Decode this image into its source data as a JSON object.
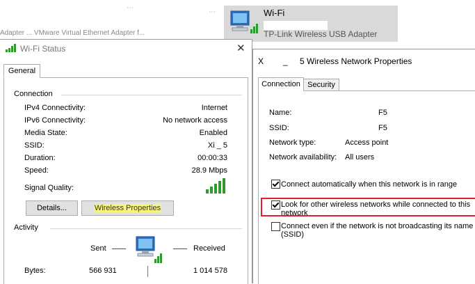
{
  "background": {
    "crumb_text": "Adapter ...      VMware Virtual Ethernet Adapter f...",
    "wifi_item": {
      "name": "Wi-Fi",
      "adapter": "TP-Link Wireless USB Adapter"
    }
  },
  "status_dialog": {
    "title": "Wi-Fi Status",
    "tab": "General",
    "connection_heading": "Connection",
    "rows": [
      {
        "label": "IPv4 Connectivity:",
        "value": "Internet"
      },
      {
        "label": "IPv6 Connectivity:",
        "value": "No network access"
      },
      {
        "label": "Media State:",
        "value": "Enabled"
      },
      {
        "label": "SSID:",
        "value": "Xi _ 5"
      },
      {
        "label": "Duration:",
        "value": "00:00:33"
      },
      {
        "label": "Speed:",
        "value": "28.9 Mbps"
      }
    ],
    "signal_label": "Signal Quality:",
    "details_button": "Details...",
    "wireless_button": "Wireless Properties",
    "activity_heading": "Activity",
    "sent_label": "Sent",
    "received_label": "Received",
    "bytes_label": "Bytes:",
    "bytes_sent": "566 931",
    "bytes_received": "1 014 578"
  },
  "props_dialog": {
    "title_prefix": "X",
    "title_gap": "_",
    "title": "5 Wireless Network Properties",
    "tabs": [
      "Connection",
      "Security"
    ],
    "fields": [
      {
        "label": "Name:",
        "value": "F5"
      },
      {
        "label": "SSID:",
        "value": "F5"
      },
      {
        "label": "Network type:",
        "value": "Access point"
      },
      {
        "label": "Network availability:",
        "value": "All users"
      }
    ],
    "checkboxes": [
      {
        "label": "Connect automatically when this network is in range",
        "checked": true
      },
      {
        "label": "Look for other wireless networks while connected to this network",
        "checked": true
      },
      {
        "label": "Connect even if the network is not broadcasting its name (SSID)",
        "checked": false
      }
    ],
    "highlight_color": "#e0212b"
  }
}
